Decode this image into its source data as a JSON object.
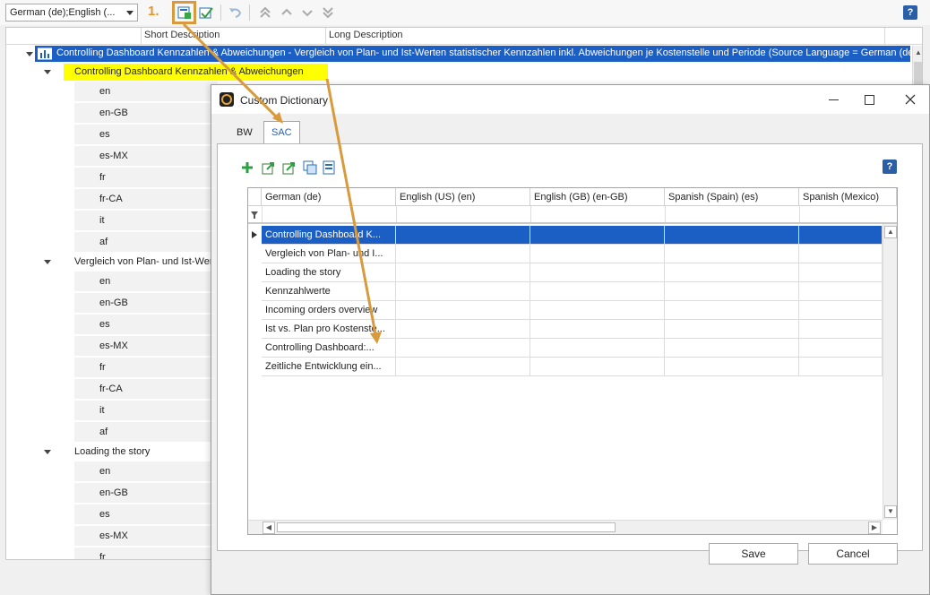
{
  "toolbar": {
    "language_combo": "German (de);English (...",
    "step_label": "1."
  },
  "tree": {
    "headers": {
      "short": "Short Description",
      "long": "Long Description"
    },
    "root_label": "Controlling Dashboard Kennzahlen & Abweichungen - Vergleich von Plan- und Ist-Werten statistischer Kennzahlen inkl. Abweichungen je Kostenstelle und Periode (Source Language = German (de))",
    "groups": [
      {
        "label": "Controlling Dashboard Kennzahlen & Abweichungen",
        "langs": [
          "en",
          "en-GB",
          "es",
          "es-MX",
          "fr",
          "fr-CA",
          "it",
          "af"
        ]
      },
      {
        "label": "Vergleich von Plan- und Ist-Wer",
        "langs": [
          "en",
          "en-GB",
          "es",
          "es-MX",
          "fr",
          "fr-CA",
          "it",
          "af"
        ]
      },
      {
        "label": "Loading the story",
        "langs": [
          "en",
          "en-GB",
          "es",
          "es-MX",
          "fr"
        ]
      }
    ]
  },
  "dialog": {
    "title": "Custom Dictionary",
    "tabs": [
      "BW",
      "SAC"
    ],
    "active_tab": "SAC",
    "columns": [
      "German (de)",
      "English (US) (en)",
      "English (GB) (en-GB)",
      "Spanish (Spain) (es)",
      "Spanish (Mexico)"
    ],
    "rows": [
      "Controlling Dashboard K...",
      "Vergleich von Plan- und I...",
      "Loading the story",
      "Kennzahlwerte",
      "Incoming orders overview",
      "Ist vs. Plan pro Kostenste...",
      "Controlling Dashboard:...",
      "Zeitliche Entwicklung ein..."
    ],
    "buttons": {
      "save": "Save",
      "cancel": "Cancel"
    }
  },
  "colors": {
    "selection": "#1c5fc4",
    "highlight": "#ffff00",
    "callout": "#d89a3c"
  }
}
